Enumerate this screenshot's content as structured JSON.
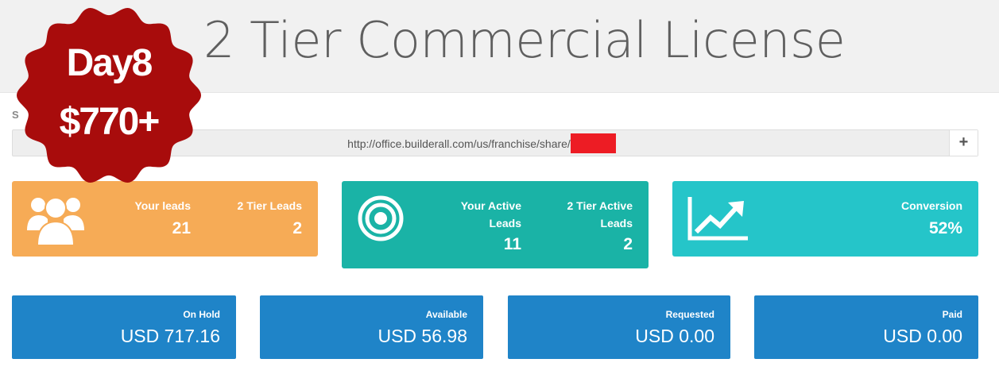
{
  "page": {
    "title": "2 Tier Commercial License"
  },
  "badge": {
    "line1": "Day8",
    "line2": "$770+",
    "color": "#a80c0c"
  },
  "share": {
    "label": "S",
    "url": "http://office.builderall.com/us/franchise/share/",
    "add_label": "+"
  },
  "stats": {
    "leads": {
      "icon": "users-icon",
      "color": "#f6ab56",
      "your_label": "Your leads",
      "your_value": "21",
      "tier_label": "2 Tier Leads",
      "tier_value": "2"
    },
    "active": {
      "icon": "target-icon",
      "color": "#1ab3a6",
      "your_label_line1": "Your Active",
      "your_label_line2": "Leads",
      "your_value": "11",
      "tier_label_line1": "2 Tier Active",
      "tier_label_line2": "Leads",
      "tier_value": "2"
    },
    "conversion": {
      "icon": "trending-chart-icon",
      "color": "#25c5c9",
      "label": "Conversion",
      "value": "52%"
    }
  },
  "balances": [
    {
      "label": "On Hold",
      "value": "USD 717.16"
    },
    {
      "label": "Available",
      "value": "USD 56.98"
    },
    {
      "label": "Requested",
      "value": "USD 0.00"
    },
    {
      "label": "Paid",
      "value": "USD 0.00"
    }
  ],
  "balance_color": "#1f84c8"
}
